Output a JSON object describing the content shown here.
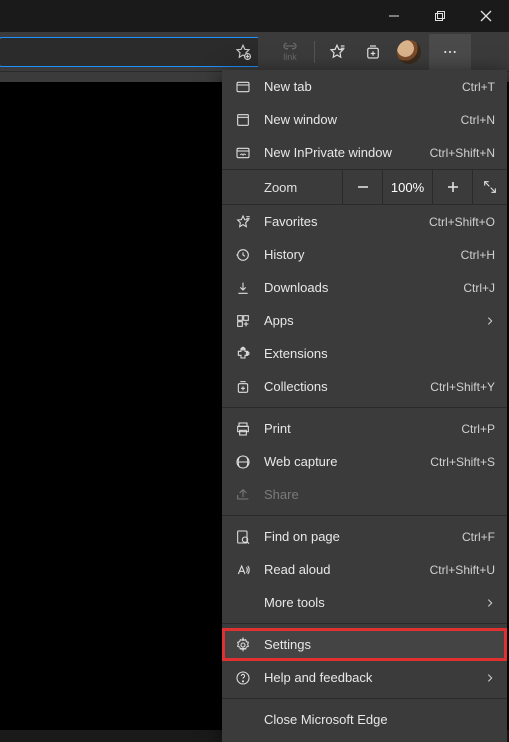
{
  "toolbar": {
    "link_label": "link"
  },
  "zoom": {
    "label": "Zoom",
    "value": "100%"
  },
  "menu": {
    "new_tab": {
      "label": "New tab",
      "shortcut": "Ctrl+T"
    },
    "new_window": {
      "label": "New window",
      "shortcut": "Ctrl+N"
    },
    "new_inprivate": {
      "label": "New InPrivate window",
      "shortcut": "Ctrl+Shift+N"
    },
    "favorites": {
      "label": "Favorites",
      "shortcut": "Ctrl+Shift+O"
    },
    "history": {
      "label": "History",
      "shortcut": "Ctrl+H"
    },
    "downloads": {
      "label": "Downloads",
      "shortcut": "Ctrl+J"
    },
    "apps": {
      "label": "Apps"
    },
    "extensions": {
      "label": "Extensions"
    },
    "collections": {
      "label": "Collections",
      "shortcut": "Ctrl+Shift+Y"
    },
    "print": {
      "label": "Print",
      "shortcut": "Ctrl+P"
    },
    "web_capture": {
      "label": "Web capture",
      "shortcut": "Ctrl+Shift+S"
    },
    "share": {
      "label": "Share"
    },
    "find": {
      "label": "Find on page",
      "shortcut": "Ctrl+F"
    },
    "read_aloud": {
      "label": "Read aloud",
      "shortcut": "Ctrl+Shift+U"
    },
    "more_tools": {
      "label": "More tools"
    },
    "settings": {
      "label": "Settings"
    },
    "help": {
      "label": "Help and feedback"
    },
    "close": {
      "label": "Close Microsoft Edge"
    }
  }
}
